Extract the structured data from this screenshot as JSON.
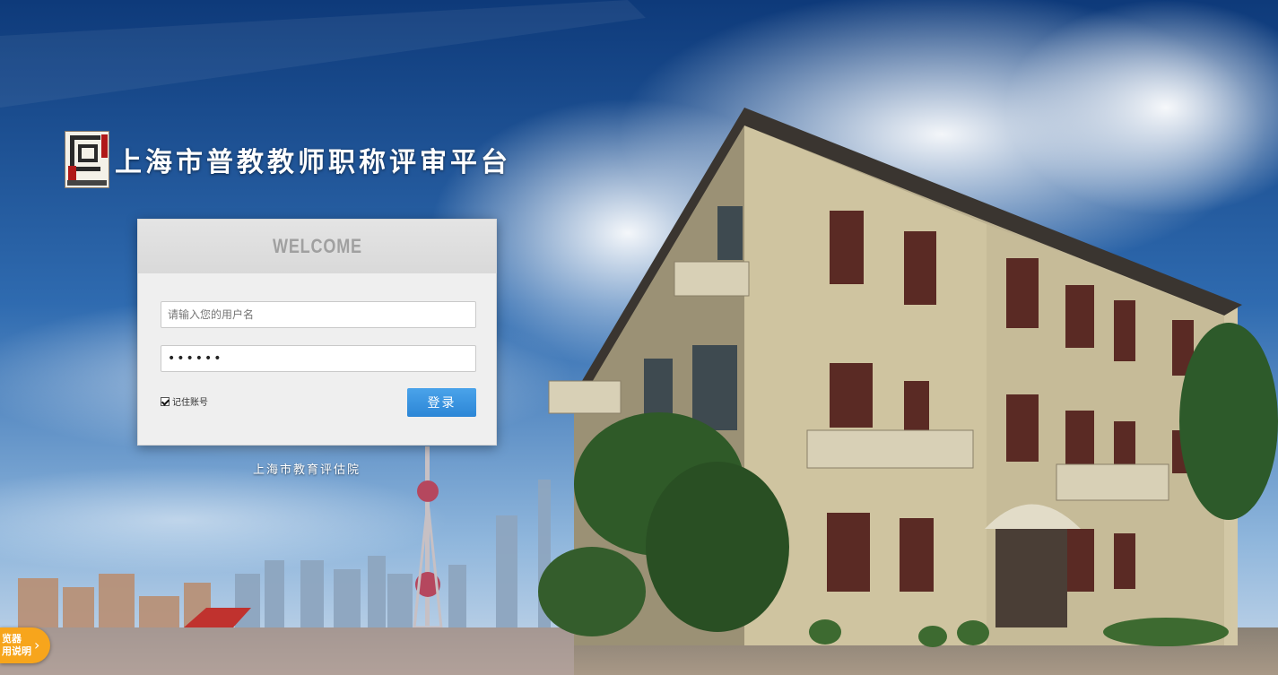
{
  "header": {
    "site_title": "上海市普教教师职称评审平台",
    "logo_icon": "see-logo-icon"
  },
  "login": {
    "welcome": "WELCOME",
    "username_placeholder": "请输入您的用户名",
    "password_value": "••••••",
    "remember_label": "记住账号",
    "remember_checked": true,
    "login_button": "登录"
  },
  "footer": {
    "organization": "上海市教育评估院",
    "browser_tip": "览器\n用说明"
  },
  "colors": {
    "button": "#2c86d6",
    "tip": "#f7a51c",
    "sky": "#1f5aa0"
  }
}
